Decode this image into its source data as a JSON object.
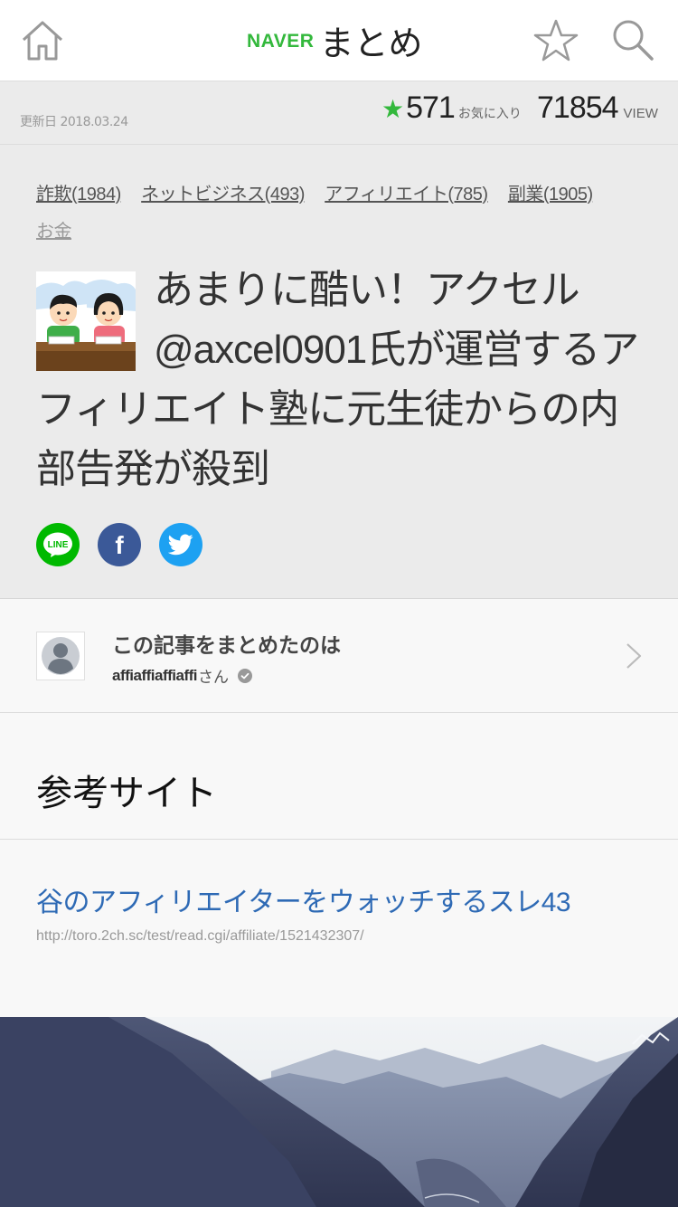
{
  "header": {
    "brand_naver": "NAVER",
    "brand_matome": "まとめ",
    "icons": {
      "home": "home-icon",
      "favorite": "star-outline-icon",
      "search": "search-icon"
    }
  },
  "stats": {
    "updated": "更新日 2018.03.24",
    "favorite_count": "571",
    "favorite_label": "お気に入り",
    "view_count": "71854",
    "view_label": "VIEW"
  },
  "tags": [
    {
      "label": "詐欺(1984)"
    },
    {
      "label": "ネットビジネス(493)"
    },
    {
      "label": "アフィリエイト(785)"
    },
    {
      "label": "副業(1905)"
    },
    {
      "label": "お金"
    }
  ],
  "article": {
    "title": "あまりに酷い！アクセル@axcel0901氏が運営するアフィリエイト塾に元生徒からの内部告発が殺到"
  },
  "share": {
    "line_label": "LINE",
    "facebook_label": "f"
  },
  "author": {
    "heading": "この記事をまとめたのは",
    "name": "affiaffiaffiaffi",
    "suffix": "さん"
  },
  "section": {
    "title": "参考サイト"
  },
  "reference": {
    "link_text": "谷のアフィリエイターをウォッチするスレ43",
    "url": "http://toro.2ch.sc/test/read.cgi/affiliate/1521432307/"
  },
  "colors": {
    "brand_green": "#33b83c",
    "link_blue": "#2e6ab5",
    "line_green": "#00b900",
    "facebook_blue": "#3b5998",
    "twitter_blue": "#1da1f2"
  }
}
